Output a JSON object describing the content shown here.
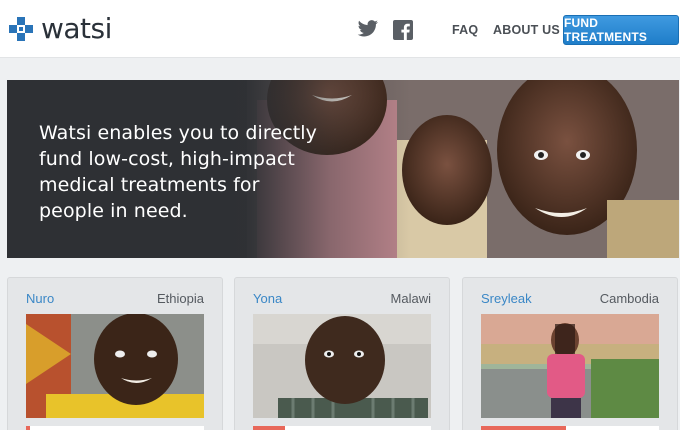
{
  "header": {
    "logo_text": "watsi",
    "nav": {
      "faq": "FAQ",
      "about": "ABOUT US"
    },
    "cta": "FUND TREATMENTS",
    "social": [
      "twitter-icon",
      "facebook-icon"
    ]
  },
  "hero": {
    "text": "Watsi enables you to directly fund low-cost, high-impact medical treatments for people in need."
  },
  "patients": [
    {
      "name": "Nuro",
      "country": "Ethiopia",
      "progress": 0.02
    },
    {
      "name": "Yona",
      "country": "Malawi",
      "progress": 0.18
    },
    {
      "name": "Sreyleak",
      "country": "Cambodia",
      "progress": 0.48
    }
  ],
  "colors": {
    "brand_blue": "#2a74b8",
    "cta_blue": "#2b8ad6",
    "link_blue": "#3a87c6",
    "progress": "#e8685a"
  }
}
